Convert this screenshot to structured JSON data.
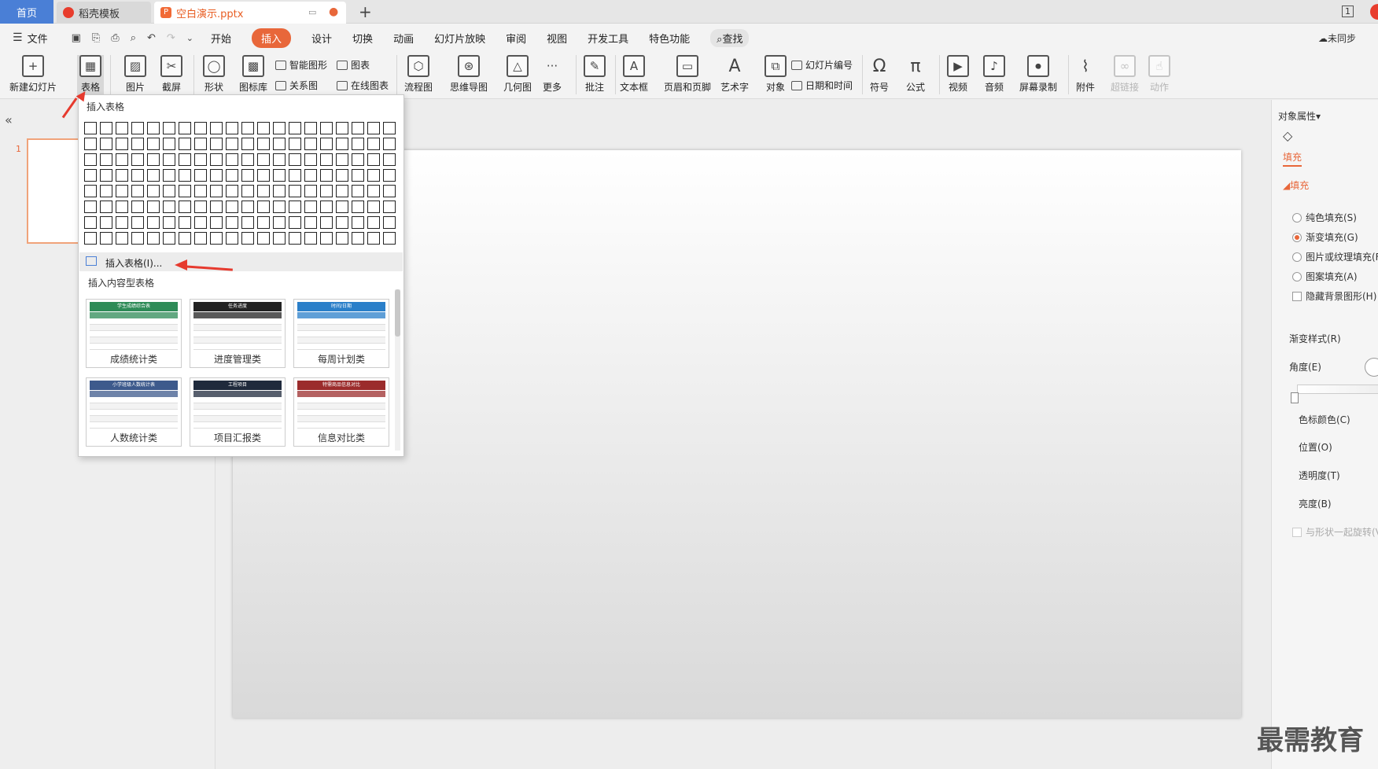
{
  "tabs": {
    "home": "首页",
    "template": "稻壳模板",
    "document": "空白演示.pptx",
    "new_tab": "+",
    "page_count": "1"
  },
  "menubar": {
    "file": "文件",
    "items": [
      "开始",
      "插入",
      "设计",
      "切换",
      "动画",
      "幻灯片放映",
      "审阅",
      "视图",
      "开发工具",
      "特色功能"
    ],
    "search": "查找",
    "sync": "未同步"
  },
  "ribbon": {
    "new_slide": "新建幻灯片",
    "table": "表格",
    "picture": "图片",
    "screenshot": "截屏",
    "shape": "形状",
    "icon_lib": "图标库",
    "smart_shape": "智能图形",
    "chart": "图表",
    "relation": "关系图",
    "online_chart": "在线图表",
    "flowchart": "流程图",
    "mindmap": "思维导图",
    "geometry": "几何图",
    "more": "更多",
    "comment": "批注",
    "textbox": "文本框",
    "header_footer": "页眉和页脚",
    "art_text": "艺术字",
    "object": "对象",
    "slide_number": "幻灯片编号",
    "date_time": "日期和时间",
    "symbol": "符号",
    "formula": "公式",
    "video": "视频",
    "audio": "音频",
    "screen_record": "屏幕录制",
    "attachment": "附件",
    "hyperlink": "超链接",
    "action": "动作"
  },
  "left_panel": {
    "slide_number": "1"
  },
  "dropdown": {
    "title": "插入表格",
    "insert_table": "插入表格(I)...",
    "content_section": "插入内容型表格",
    "templates": [
      {
        "label": "成绩统计类",
        "header": "学生成绩综合表",
        "color": "#2e8b57"
      },
      {
        "label": "进度管理类",
        "header": "任务进度",
        "color": "#222222"
      },
      {
        "label": "每周计划类",
        "header": "时间/日期",
        "color": "#2a7fc9"
      },
      {
        "label": "人数统计类",
        "header": "小学班级人数统计表",
        "color": "#3d5a8c"
      },
      {
        "label": "项目汇报类",
        "header": "工程项目",
        "color": "#1f2a3c"
      },
      {
        "label": "信息对比类",
        "header": "特需商品信息对比",
        "color": "#9b2c2c"
      }
    ],
    "grid_rows": 8,
    "grid_cols": 20
  },
  "right_panel": {
    "title": "对象属性",
    "tab_fill": "填充",
    "section_fill": "填充",
    "options": [
      "纯色填充(S)",
      "渐变填充(G)",
      "图片或纹理填充(F",
      "图案填充(A)"
    ],
    "selected_option": "渐变填充(G)",
    "hide_bg": "隐藏背景图形(H)",
    "gradient_style": "渐变样式(R)",
    "angle": "角度(E)",
    "stop_color": "色标颜色(C)",
    "position": "位置(O)",
    "transparency": "透明度(T)",
    "brightness": "亮度(B)",
    "rotate_with_shape": "与形状一起旋转(V"
  },
  "watermark": "最需教育",
  "colors": {
    "accent": "#e8673a",
    "home_tab": "#4a7fd6",
    "arrow": "#e63a2e"
  }
}
